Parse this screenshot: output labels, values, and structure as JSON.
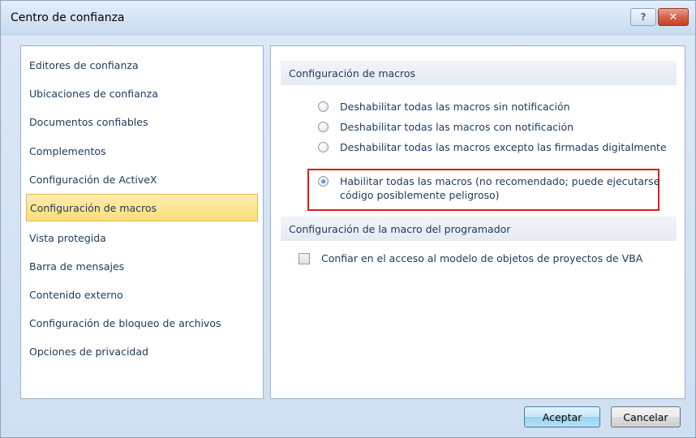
{
  "window": {
    "title": "Centro de confianza"
  },
  "titlebar": {
    "help_icon": "question-icon",
    "close_icon": "close-icon"
  },
  "sidebar": {
    "items": [
      {
        "label": "Editores de confianza",
        "active": false
      },
      {
        "label": "Ubicaciones de confianza",
        "active": false
      },
      {
        "label": "Documentos confiables",
        "active": false
      },
      {
        "label": "Complementos",
        "active": false
      },
      {
        "label": "Configuración de ActiveX",
        "active": false
      },
      {
        "label": "Configuración de macros",
        "active": true
      },
      {
        "label": "Vista protegida",
        "active": false
      },
      {
        "label": "Barra de mensajes",
        "active": false
      },
      {
        "label": "Contenido externo",
        "active": false
      },
      {
        "label": "Configuración de bloqueo de archivos",
        "active": false
      },
      {
        "label": "Opciones de privacidad",
        "active": false
      }
    ]
  },
  "macro_settings": {
    "header": "Configuración de macros",
    "options": [
      {
        "label": "Deshabilitar todas las macros sin notificación",
        "checked": false
      },
      {
        "label": "Deshabilitar todas las macros con notificación",
        "checked": false
      },
      {
        "label": "Deshabilitar todas las macros excepto las firmadas digitalmente",
        "checked": false
      },
      {
        "label": "Habilitar todas las macros (no recomendado; puede ejecutarse código posiblemente peligroso)",
        "checked": true
      }
    ]
  },
  "developer_settings": {
    "header": "Configuración de la macro del programador",
    "checkbox_label": "Confiar en el acceso al modelo de objetos de proyectos de VBA",
    "checked": false
  },
  "buttons": {
    "ok": "Aceptar",
    "cancel": "Cancelar"
  },
  "colors": {
    "highlight_border": "#e01b1b",
    "active_item": "#fbdc76"
  }
}
